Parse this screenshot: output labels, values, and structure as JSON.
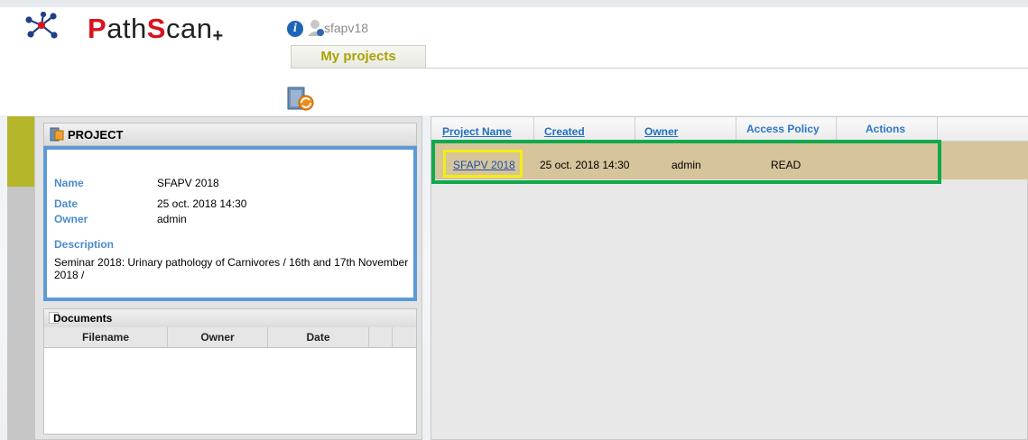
{
  "header": {
    "logo_prefix_red": "P",
    "logo_part1": "ath",
    "logo_s_red": "S",
    "logo_part2": "can",
    "logo_plus": "+",
    "username": "sfapv18",
    "info_icon": "info-icon",
    "user_icon": "user-icon"
  },
  "tabs": [
    {
      "label": "My projects"
    }
  ],
  "toolbar": {
    "refresh_icon": "refresh-icon"
  },
  "project_panel": {
    "title": "PROJECT",
    "name_label": "Name",
    "name_value": "SFAPV 2018",
    "date_label": "Date",
    "date_value": "25 oct. 2018 14:30",
    "owner_label": "Owner",
    "owner_value": "admin",
    "description_label": "Description",
    "description_value": "Seminar 2018: Urinary pathology of Carnivores / 16th and 17th November 2018 /"
  },
  "documents_panel": {
    "title": "Documents",
    "columns": [
      "Filename",
      "Owner",
      "Date"
    ]
  },
  "projects_grid": {
    "columns": [
      "Project Name",
      "Created",
      "Owner",
      "Access Policy",
      "Actions"
    ],
    "rows": [
      {
        "project_name": "SFAPV 2018",
        "created": "25 oct. 2018 14:30",
        "owner": "admin",
        "access_policy": "READ",
        "actions": ""
      }
    ]
  },
  "colors": {
    "highlight_green": "#10a94e",
    "highlight_yellow": "#f2ef12",
    "row_selected": "#d6c49a",
    "label_blue": "#4b8bc9",
    "brand_red": "#d9121e",
    "tab_text": "#a9a300"
  }
}
